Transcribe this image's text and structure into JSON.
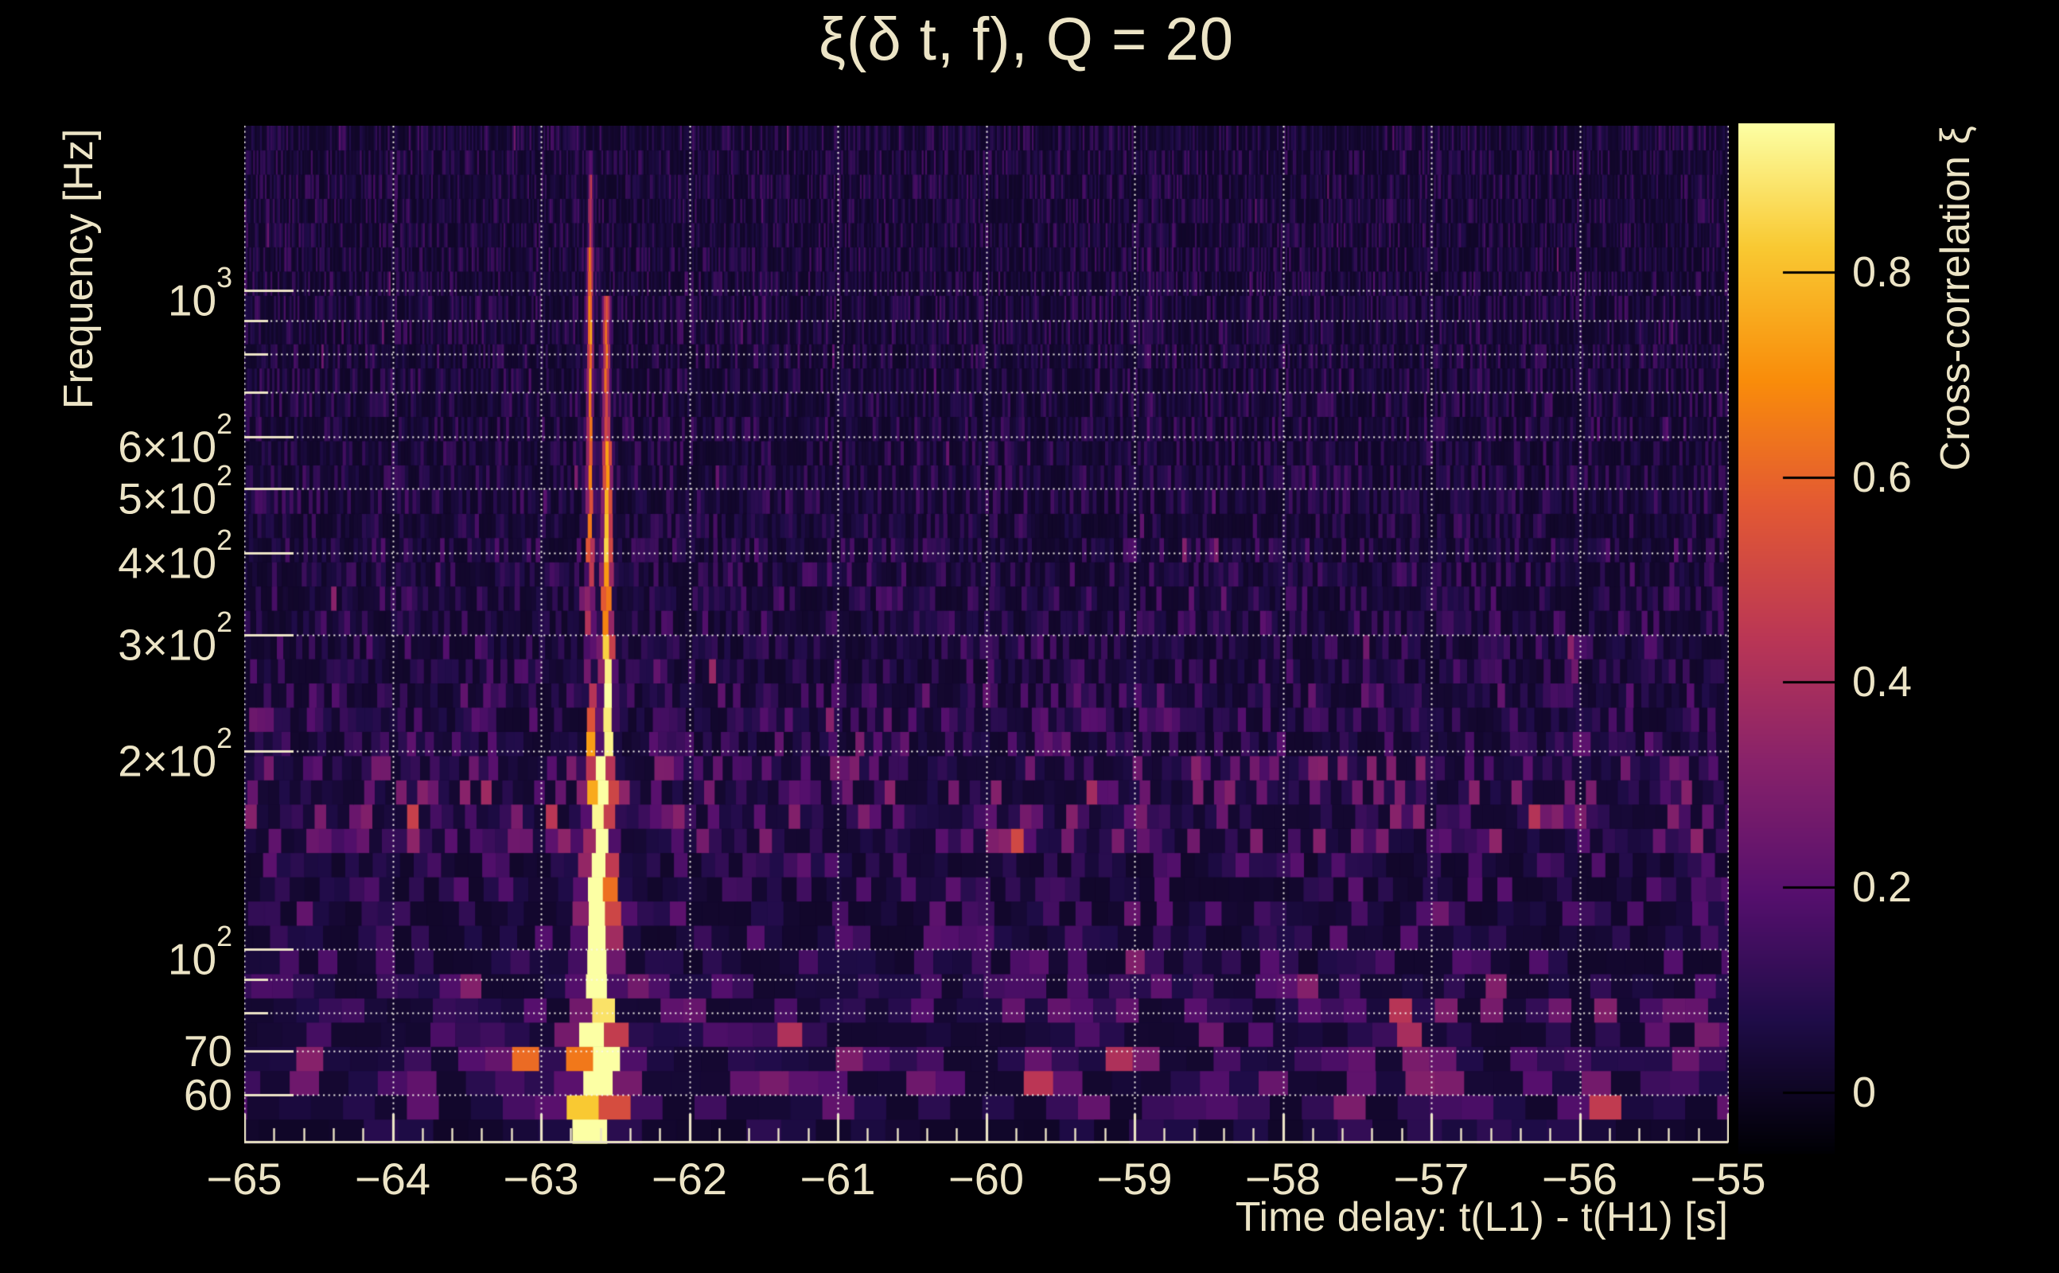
{
  "page": {
    "background": "#000000",
    "text_color": "#ece4c6"
  },
  "chart_data": {
    "type": "heatmap",
    "title": "ξ(δ t, f), Q = 20",
    "q_value": 20,
    "xlabel": "Time delay: t(L1) - t(H1) [s]",
    "ylabel": "Frequency [Hz]",
    "colorbar_label": "Cross-correlation ξ",
    "x_range_s": [
      -65,
      -55
    ],
    "y_range_hz": [
      50.7,
      1780
    ],
    "y_scale": "log",
    "grid": "dotted-white",
    "color_scale_range": [
      -0.06,
      0.945
    ],
    "x_ticks": [
      {
        "v": -65,
        "label": "−65"
      },
      {
        "v": -64,
        "label": "−64"
      },
      {
        "v": -63,
        "label": "−63"
      },
      {
        "v": -62,
        "label": "−62"
      },
      {
        "v": -61,
        "label": "−61"
      },
      {
        "v": -60,
        "label": "−60"
      },
      {
        "v": -59,
        "label": "−59"
      },
      {
        "v": -58,
        "label": "−58"
      },
      {
        "v": -57,
        "label": "−57"
      },
      {
        "v": -56,
        "label": "−56"
      },
      {
        "v": -55,
        "label": "−55"
      }
    ],
    "x_minor_tick_step_s": 0.2,
    "y_ticks": [
      {
        "f": 1000,
        "mant": "10",
        "exp": "3"
      },
      {
        "f": 600,
        "mant": "6×10",
        "exp": "2"
      },
      {
        "f": 500,
        "mant": "5×10",
        "exp": "2"
      },
      {
        "f": 400,
        "mant": "4×10",
        "exp": "2"
      },
      {
        "f": 300,
        "mant": "3×10",
        "exp": "2"
      },
      {
        "f": 200,
        "mant": "2×10",
        "exp": "2"
      },
      {
        "f": 100,
        "mant": "10",
        "exp": "2"
      },
      {
        "f": 70,
        "mant": "70",
        "exp": ""
      },
      {
        "f": 60,
        "mant": "60",
        "exp": ""
      }
    ],
    "grid_freqs_hz": [
      60,
      70,
      80,
      90,
      100,
      200,
      300,
      400,
      500,
      600,
      700,
      800,
      900,
      1000
    ],
    "colorbar_ticks": [
      {
        "v": 0.8,
        "label": "0.8"
      },
      {
        "v": 0.6,
        "label": "0.6"
      },
      {
        "v": 0.4,
        "label": "0.4"
      },
      {
        "v": 0.2,
        "label": "0.2"
      },
      {
        "v": 0.0,
        "label": "0"
      }
    ],
    "colormap": {
      "name": "inferno",
      "anchors": [
        [
          0.0,
          "#000004"
        ],
        [
          0.13,
          "#1f0c48"
        ],
        [
          0.25,
          "#550f6d"
        ],
        [
          0.38,
          "#88226a"
        ],
        [
          0.5,
          "#ba3655"
        ],
        [
          0.63,
          "#e35933"
        ],
        [
          0.75,
          "#f98c0a"
        ],
        [
          0.88,
          "#f9c932"
        ],
        [
          1.0,
          "#fcffa4"
        ]
      ]
    },
    "tiling": {
      "rows": 42,
      "tile_time_width_s_times_hz": 12.4,
      "seed": 13
    },
    "noise_profile": [
      {
        "f_lo": 50,
        "f_hi": 56,
        "base": 0.05
      },
      {
        "f_lo": 56,
        "f_hi": 62,
        "base": 0.095
      },
      {
        "f_lo": 62,
        "f_hi": 90,
        "base": 0.125
      },
      {
        "f_lo": 90,
        "f_hi": 135,
        "base": 0.085
      },
      {
        "f_lo": 135,
        "f_hi": 190,
        "base": 0.135
      },
      {
        "f_lo": 190,
        "f_hi": 260,
        "base": 0.095
      },
      {
        "f_lo": 260,
        "f_hi": 420,
        "base": 0.075
      },
      {
        "f_lo": 420,
        "f_hi": 1780,
        "base": 0.065
      }
    ],
    "signal_tracks": [
      {
        "t": -62.67,
        "f_lo": 200,
        "f_hi": 1150,
        "sigma_t": 0.013,
        "amp": 0.62
      },
      {
        "t": -62.665,
        "f_lo": 1150,
        "f_hi": 1520,
        "sigma_t": 0.011,
        "amp": 0.4
      },
      {
        "t": -62.66,
        "f_lo": 1520,
        "f_hi": 1700,
        "sigma_t": 0.01,
        "amp": 0.14
      },
      {
        "t": -62.56,
        "f_lo": 600,
        "f_hi": 950,
        "sigma_t": 0.018,
        "amp": 0.5
      },
      {
        "t": -62.555,
        "f_lo": 300,
        "f_hi": 600,
        "sigma_t": 0.022,
        "amp": 0.72
      },
      {
        "t": -62.55,
        "f_lo": 190,
        "f_hi": 300,
        "sigma_t": 0.027,
        "amp": 0.88
      },
      {
        "t": -62.6,
        "f_lo": 95,
        "f_hi": 190,
        "sigma_t": 0.05,
        "amp": 0.95
      },
      {
        "t": -62.62,
        "f_lo": 50,
        "f_hi": 95,
        "sigma_t": 0.066,
        "amp": 1.0
      },
      {
        "t": -62.62,
        "f_lo": 90,
        "f_hi": 140,
        "sigma_t": 0.095,
        "amp": 0.32
      },
      {
        "t": -62.62,
        "f_lo": 56,
        "f_hi": 78,
        "sigma_t": 0.14,
        "amp": 0.42
      },
      {
        "t": -62.63,
        "f_lo": 50,
        "f_hi": 57,
        "sigma_t": 0.11,
        "amp": 0.3
      }
    ],
    "hotspots": [
      {
        "t": -58.35,
        "f_lo": 56,
        "f_hi": 68,
        "sigma_t": 0.035,
        "amp": 0.5
      },
      {
        "t": -55.85,
        "f_lo": 56,
        "f_hi": 66,
        "sigma_t": 0.03,
        "amp": 0.52
      },
      {
        "t": -57.2,
        "f_lo": 58,
        "f_hi": 82,
        "sigma_t": 0.032,
        "amp": 0.38
      },
      {
        "t": -57.0,
        "f_lo": 55,
        "f_hi": 64,
        "sigma_t": 0.05,
        "amp": 0.26
      },
      {
        "t": -57.52,
        "f_lo": 57,
        "f_hi": 70,
        "sigma_t": 0.035,
        "amp": 0.3
      },
      {
        "t": -56.05,
        "f_lo": 245,
        "f_hi": 290,
        "sigma_t": 0.012,
        "amp": 0.44
      },
      {
        "t": -61.85,
        "f_lo": 250,
        "f_hi": 292,
        "sigma_t": 0.012,
        "amp": 0.38
      },
      {
        "t": -60.0,
        "f_lo": 148,
        "f_hi": 172,
        "sigma_t": 0.015,
        "amp": 0.42
      },
      {
        "t": -59.0,
        "f_lo": 80,
        "f_hi": 118,
        "sigma_t": 0.02,
        "amp": 0.28
      },
      {
        "t": -64.55,
        "f_lo": 62,
        "f_hi": 80,
        "sigma_t": 0.04,
        "amp": 0.3
      },
      {
        "t": -63.1,
        "f_lo": 62,
        "f_hi": 78,
        "sigma_t": 0.03,
        "amp": 0.32
      },
      {
        "t": -61.0,
        "f_lo": 58,
        "f_hi": 70,
        "sigma_t": 0.03,
        "amp": 0.26
      },
      {
        "t": -59.62,
        "f_lo": 58,
        "f_hi": 72,
        "sigma_t": 0.03,
        "amp": 0.24
      },
      {
        "t": -55.38,
        "f_lo": 150,
        "f_hi": 175,
        "sigma_t": 0.012,
        "amp": 0.33
      },
      {
        "t": -63.86,
        "f_lo": 140,
        "f_hi": 172,
        "sigma_t": 0.015,
        "amp": 0.3
      },
      {
        "t": -63.35,
        "f_lo": 148,
        "f_hi": 180,
        "sigma_t": 0.014,
        "amp": 0.26
      },
      {
        "t": -64.6,
        "f_lo": 110,
        "f_hi": 135,
        "sigma_t": 0.018,
        "amp": 0.22
      },
      {
        "t": -56.95,
        "f_lo": 100,
        "f_hi": 165,
        "sigma_t": 0.018,
        "amp": 0.22
      },
      {
        "t": -58.9,
        "f_lo": 600,
        "f_hi": 1300,
        "sigma_t": 0.012,
        "amp": 0.09
      },
      {
        "t": -61.5,
        "f_lo": 700,
        "f_hi": 1500,
        "sigma_t": 0.012,
        "amp": 0.08
      }
    ]
  }
}
